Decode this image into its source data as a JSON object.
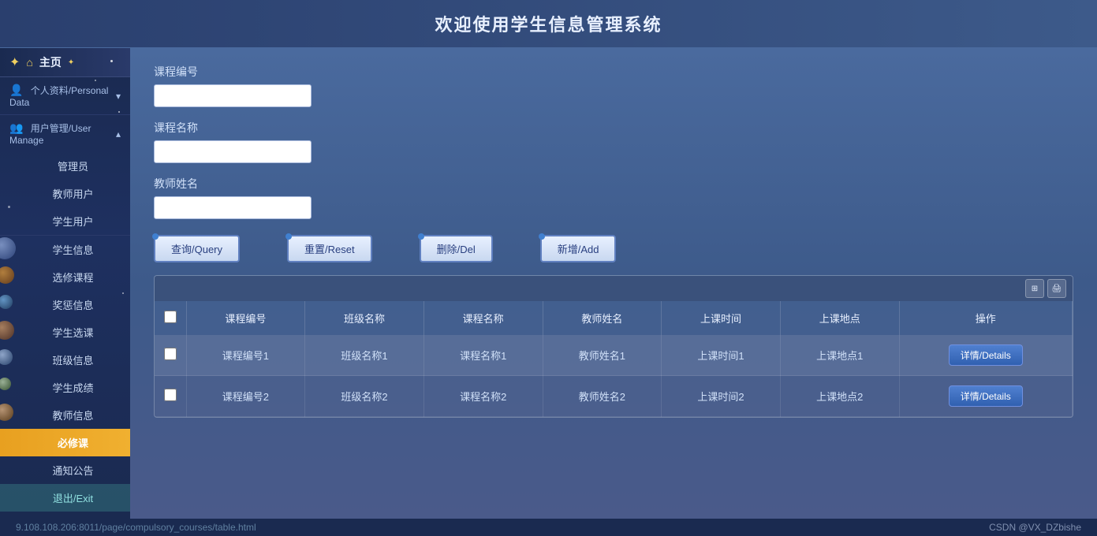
{
  "header": {
    "title": "欢迎使用学生信息管理系统"
  },
  "sidebar": {
    "top": {
      "home_label": "主页"
    },
    "sections": [
      {
        "id": "personal",
        "label": "个人资料/Personal Data",
        "expanded": false,
        "items": []
      },
      {
        "id": "user-manage",
        "label": "用户管理/User Manage",
        "expanded": true,
        "items": [
          {
            "id": "admin",
            "label": "管理员"
          },
          {
            "id": "teacher-user",
            "label": "教师用户"
          },
          {
            "id": "student-user",
            "label": "学生用户"
          }
        ]
      },
      {
        "id": "student-info",
        "label": "学生信息",
        "items": []
      },
      {
        "id": "course-select",
        "label": "选修课程",
        "items": []
      },
      {
        "id": "awards",
        "label": "奖惩信息",
        "items": []
      },
      {
        "id": "student-elective",
        "label": "学生选课",
        "items": []
      },
      {
        "id": "class-info",
        "label": "班级信息",
        "items": []
      },
      {
        "id": "student-grades",
        "label": "学生成绩",
        "items": []
      },
      {
        "id": "teacher-info",
        "label": "教师信息",
        "items": []
      },
      {
        "id": "compulsory",
        "label": "必修课",
        "active": true,
        "items": []
      },
      {
        "id": "notice",
        "label": "通知公告",
        "items": []
      },
      {
        "id": "exit",
        "label": "退出/Exit",
        "items": []
      }
    ]
  },
  "form": {
    "course_id_label": "课程编号",
    "course_id_value": "",
    "course_name_label": "课程名称",
    "course_name_value": "",
    "teacher_name_label": "教师姓名",
    "teacher_name_value": ""
  },
  "buttons": {
    "query": "查询/Query",
    "reset": "重置/Reset",
    "delete": "删除/Del",
    "add": "新增/Add"
  },
  "table": {
    "columns": [
      "课程编号",
      "班级名称",
      "课程名称",
      "教师姓名",
      "上课时间",
      "上课地点",
      "操作"
    ],
    "rows": [
      {
        "course_id": "课程编号1",
        "class_name": "班级名称1",
        "course_name": "课程名称1",
        "teacher_name": "教师姓名1",
        "class_time": "上课时间1",
        "location": "上课地点1",
        "action": "详情/Details"
      },
      {
        "course_id": "课程编号2",
        "class_name": "班级名称2",
        "course_name": "课程名称2",
        "teacher_name": "教师姓名2",
        "class_time": "上课时间2",
        "location": "上课地点2",
        "action": "详情/Details"
      }
    ]
  },
  "footer": {
    "url": "9.108.108.206:8011/page/compulsory_courses/table.html",
    "credit": "CSDN @VX_DZbishe"
  }
}
